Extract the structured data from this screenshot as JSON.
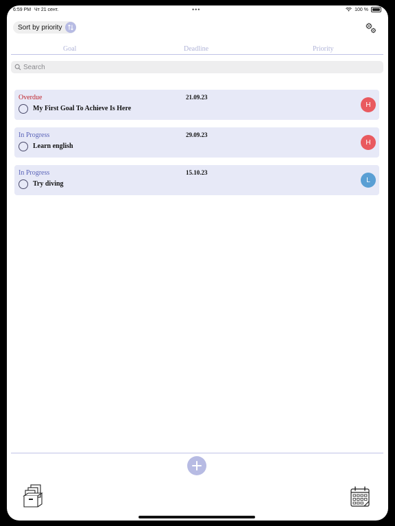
{
  "status_bar": {
    "time": "6:59 PM",
    "date": "Чт 21 сент.",
    "dots": "•••",
    "battery": "100 %"
  },
  "toolbar": {
    "sort_label": "Sort by priority",
    "sort_icon": "swap-vertical-icon",
    "settings_icon": "gears-icon"
  },
  "tabs": [
    {
      "label": "Goal"
    },
    {
      "label": "Deadline"
    },
    {
      "label": "Priority"
    }
  ],
  "search": {
    "placeholder": "Search",
    "value": ""
  },
  "goals": [
    {
      "status": "Overdue",
      "status_color": "#c0262d",
      "date": "21.09.23",
      "title": "My First Goal To Achieve Is Here",
      "priority": "H",
      "priority_color": "#e95a5f",
      "done": false
    },
    {
      "status": "In Progress",
      "status_color": "#5a63b8",
      "date": "29.09.23",
      "title": "Learn english",
      "priority": "H",
      "priority_color": "#e95a5f",
      "done": false
    },
    {
      "status": "In Progress",
      "status_color": "#5a63b8",
      "date": "15.10.23",
      "title": "Try diving",
      "priority": "L",
      "priority_color": "#5a9fd4",
      "done": false
    }
  ],
  "bottom_bar": {
    "add_icon": "plus-icon",
    "archive_icon": "archive-boxes-icon",
    "calendar_icon": "calendar-icon"
  },
  "colors": {
    "accent": "#b7bbe3",
    "card_background": "#e7e9f7",
    "tab_text": "#b0b4d8"
  }
}
